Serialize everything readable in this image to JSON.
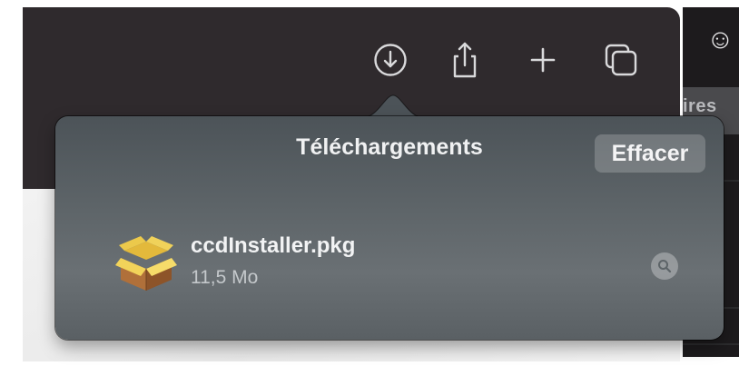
{
  "toolbar": {
    "icons": [
      "download-icon",
      "share-icon",
      "plus-icon",
      "tabs-overview-icon"
    ],
    "smiley_icon": "smiley-icon",
    "smiley_glyph": "☺"
  },
  "right_panel": {
    "partial_tab_text": "ires"
  },
  "downloads_popover": {
    "title": "Téléchargements",
    "clear_label": "Effacer",
    "items": [
      {
        "file_name": "ccdInstaller.pkg",
        "file_size": "11,5 Mo",
        "icon": "package-icon"
      }
    ]
  },
  "colors": {
    "toolbar_bg": "#2f2a2d",
    "popover_bg": "#5d6468",
    "text_primary": "#f2f3f4",
    "text_secondary": "#c4c8cb"
  }
}
